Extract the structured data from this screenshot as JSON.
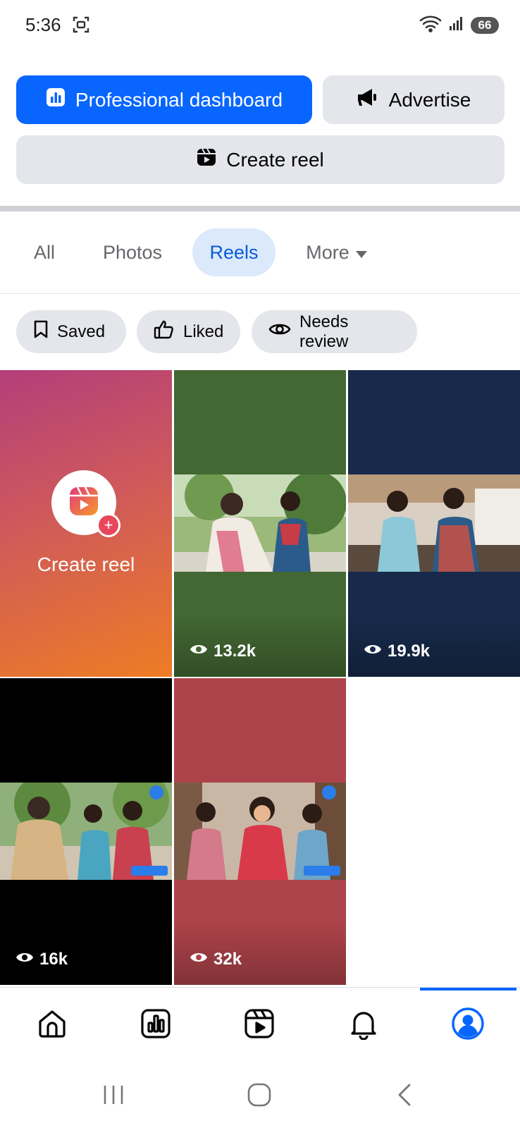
{
  "status_bar": {
    "time": "5:36",
    "battery": "66"
  },
  "actions": {
    "professional_dashboard": "Professional dashboard",
    "advertise": "Advertise",
    "create_reel": "Create reel"
  },
  "tabs": [
    {
      "label": "All"
    },
    {
      "label": "Photos"
    },
    {
      "label": "Reels",
      "selected": true
    },
    {
      "label": "More"
    }
  ],
  "filters": [
    {
      "label": "Saved",
      "icon": "bookmark-icon"
    },
    {
      "label": "Liked",
      "icon": "thumbs-up-icon"
    },
    {
      "label": "Needs review",
      "icon": "eye-icon"
    }
  ],
  "grid": {
    "create_tile_label": "Create reel",
    "reels": [
      {
        "views": "13.2k",
        "background": "#436833"
      },
      {
        "views": "19.9k",
        "background": "#172a4a"
      },
      {
        "views": "16k",
        "background": "#000000"
      },
      {
        "views": "32k",
        "background": "#ad434a"
      }
    ]
  },
  "bottom_nav": {
    "items": [
      "home-icon",
      "dashboard-icon",
      "reels-icon",
      "bell-icon",
      "profile-icon"
    ],
    "active": "profile-icon"
  },
  "colors": {
    "accent": "#0866ff",
    "chip_bg": "#e4e6eb",
    "selected_tab_bg": "#dbe9fb"
  }
}
